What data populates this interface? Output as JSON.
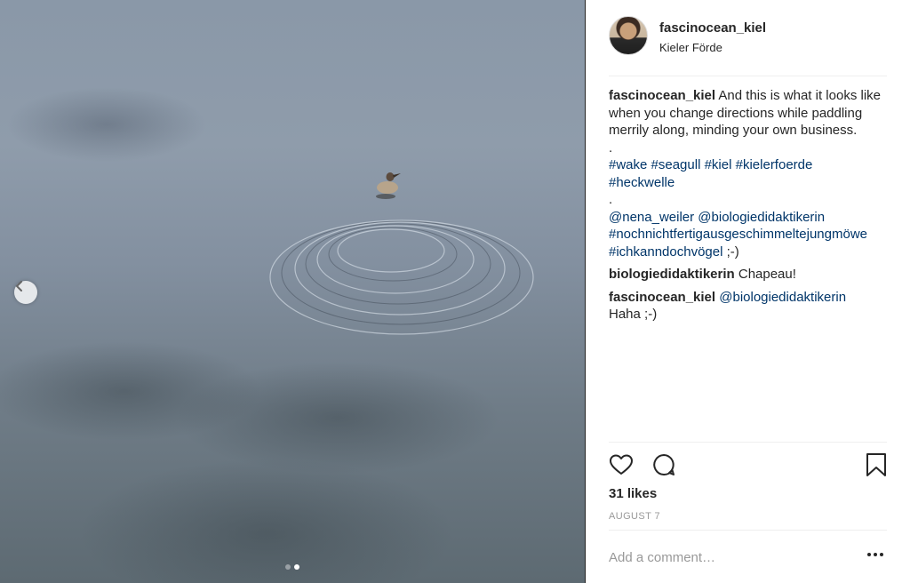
{
  "post": {
    "username": "fascinocean_kiel",
    "location": "Kieler Förde",
    "caption": {
      "text": "And this is what it looks like when you change directions while paddling merrily along, minding your own business.",
      "dot1": ".",
      "hashtags": [
        "#wake",
        "#seagull",
        "#kiel",
        "#kielerfoerde",
        "#heckwelle"
      ],
      "dot2": ".",
      "mentions": [
        "@nena_weiler",
        "@biologiedidaktikerin"
      ],
      "tags2": [
        "#nochnichtfertigausgeschimmeltejungmöwe",
        "#ichkanndochvögel"
      ],
      "suffix": ";-)"
    },
    "comments": [
      {
        "user": "biologiedidaktikerin",
        "text": "Chapeau!"
      },
      {
        "user": "fascinocean_kiel",
        "mention": "@biologiedidaktikerin",
        "text": "Haha ;-)"
      }
    ],
    "likes": "31 likes",
    "date": "AUGUST 7",
    "add_comment_placeholder": "Add a comment…",
    "carousel": {
      "count": 2,
      "active": 2
    }
  },
  "icons": {
    "like": "heart-icon",
    "comment": "comment-icon",
    "save": "bookmark-icon",
    "prev": "chevron-left-icon",
    "more": "more-options-icon"
  },
  "colors": {
    "link": "#003569",
    "muted": "#999999",
    "text": "#262626"
  }
}
